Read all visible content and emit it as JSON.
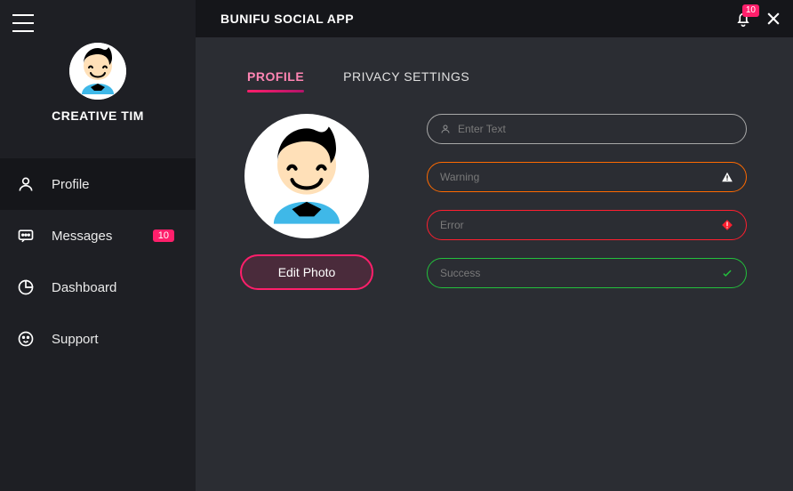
{
  "header": {
    "app_title": "BUNIFU SOCIAL APP",
    "notifications_count": "10"
  },
  "sidebar": {
    "username": "CREATIVE TIM",
    "items": [
      {
        "label": "Profile",
        "icon": "user",
        "active": true,
        "badge": null
      },
      {
        "label": "Messages",
        "icon": "message",
        "active": false,
        "badge": "10"
      },
      {
        "label": "Dashboard",
        "icon": "pie",
        "active": false,
        "badge": null
      },
      {
        "label": "Support",
        "icon": "support",
        "active": false,
        "badge": null
      }
    ]
  },
  "tabs": [
    {
      "label": "PROFILE",
      "active": true
    },
    {
      "label": "PRIVACY SETTINGS",
      "active": false
    }
  ],
  "photo_section": {
    "edit_label": "Edit Photo"
  },
  "fields": {
    "default": {
      "placeholder": "Enter Text"
    },
    "warning": {
      "placeholder": "Warning"
    },
    "error": {
      "placeholder": "Error"
    },
    "success": {
      "placeholder": "Success"
    }
  }
}
